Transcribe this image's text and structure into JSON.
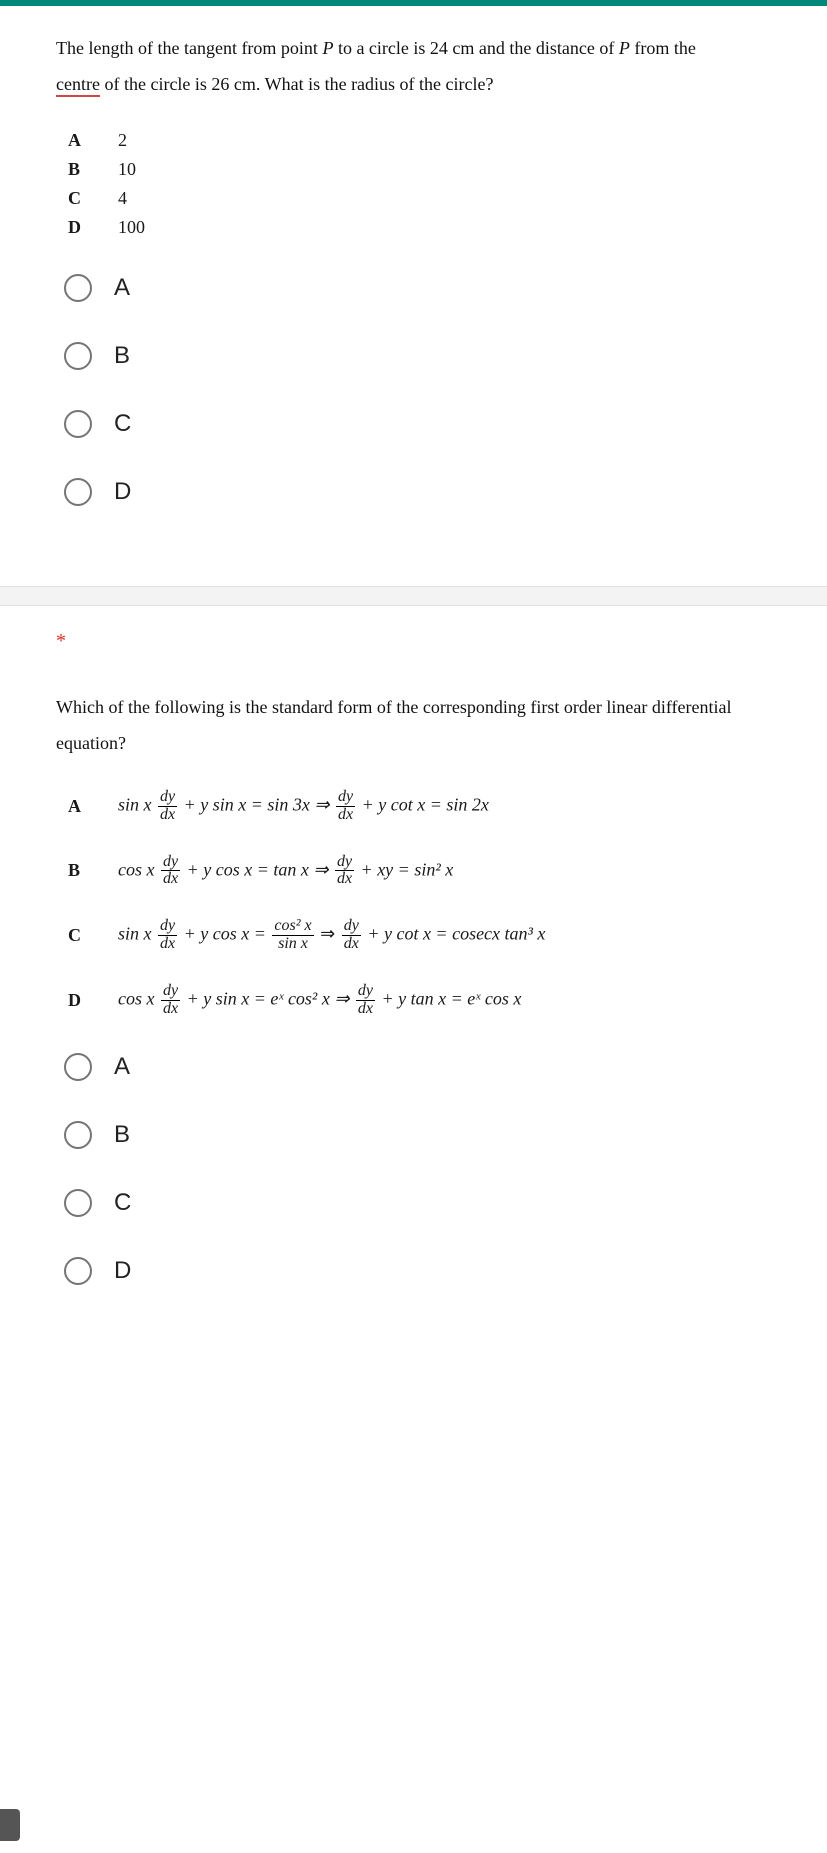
{
  "q1": {
    "text_part1": "The length of the tangent from point ",
    "text_italic1": "P",
    "text_part2": " to a circle is 24 cm and the distance of ",
    "text_italic2": "P",
    "text_part3": " from the ",
    "underlined": "centre",
    "text_part4": " of the circle is 26 cm. What is the radius of the circle?",
    "options": [
      {
        "label": "A",
        "value": "2"
      },
      {
        "label": "B",
        "value": "10"
      },
      {
        "label": "C",
        "value": "4"
      },
      {
        "label": "D",
        "value": "100"
      }
    ],
    "radios": [
      "A",
      "B",
      "C",
      "D"
    ]
  },
  "q2": {
    "required": "*",
    "text": "Which of the following is the standard form of the corresponding first order linear differential equation?",
    "eq_options": [
      {
        "label": "A",
        "lhs_pre": "sin x",
        "lhs_post": " + y sin x = sin 3x ⇒ ",
        "rhs_post": " + y cot x = sin 2x"
      },
      {
        "label": "B",
        "lhs_pre": "cos x",
        "lhs_post": " + y cos x = tan x ⇒ ",
        "rhs_post": " + xy = sin² x"
      },
      {
        "label": "C",
        "lhs_pre": "sin x",
        "lhs_post": " + y cos x = ",
        "mid_frac_num": "cos² x",
        "mid_frac_den": "sin x",
        "mid_arrow": " ⇒ ",
        "rhs_post": " + y cot x = cosecx tan³ x"
      },
      {
        "label": "D",
        "lhs_pre": "cos x",
        "lhs_post": " + y sin x = eˣ cos² x ⇒ ",
        "rhs_post": " + y tan x = eˣ cos x"
      }
    ],
    "radios": [
      "A",
      "B",
      "C",
      "D"
    ]
  },
  "frac": {
    "num": "dy",
    "den": "dx"
  }
}
